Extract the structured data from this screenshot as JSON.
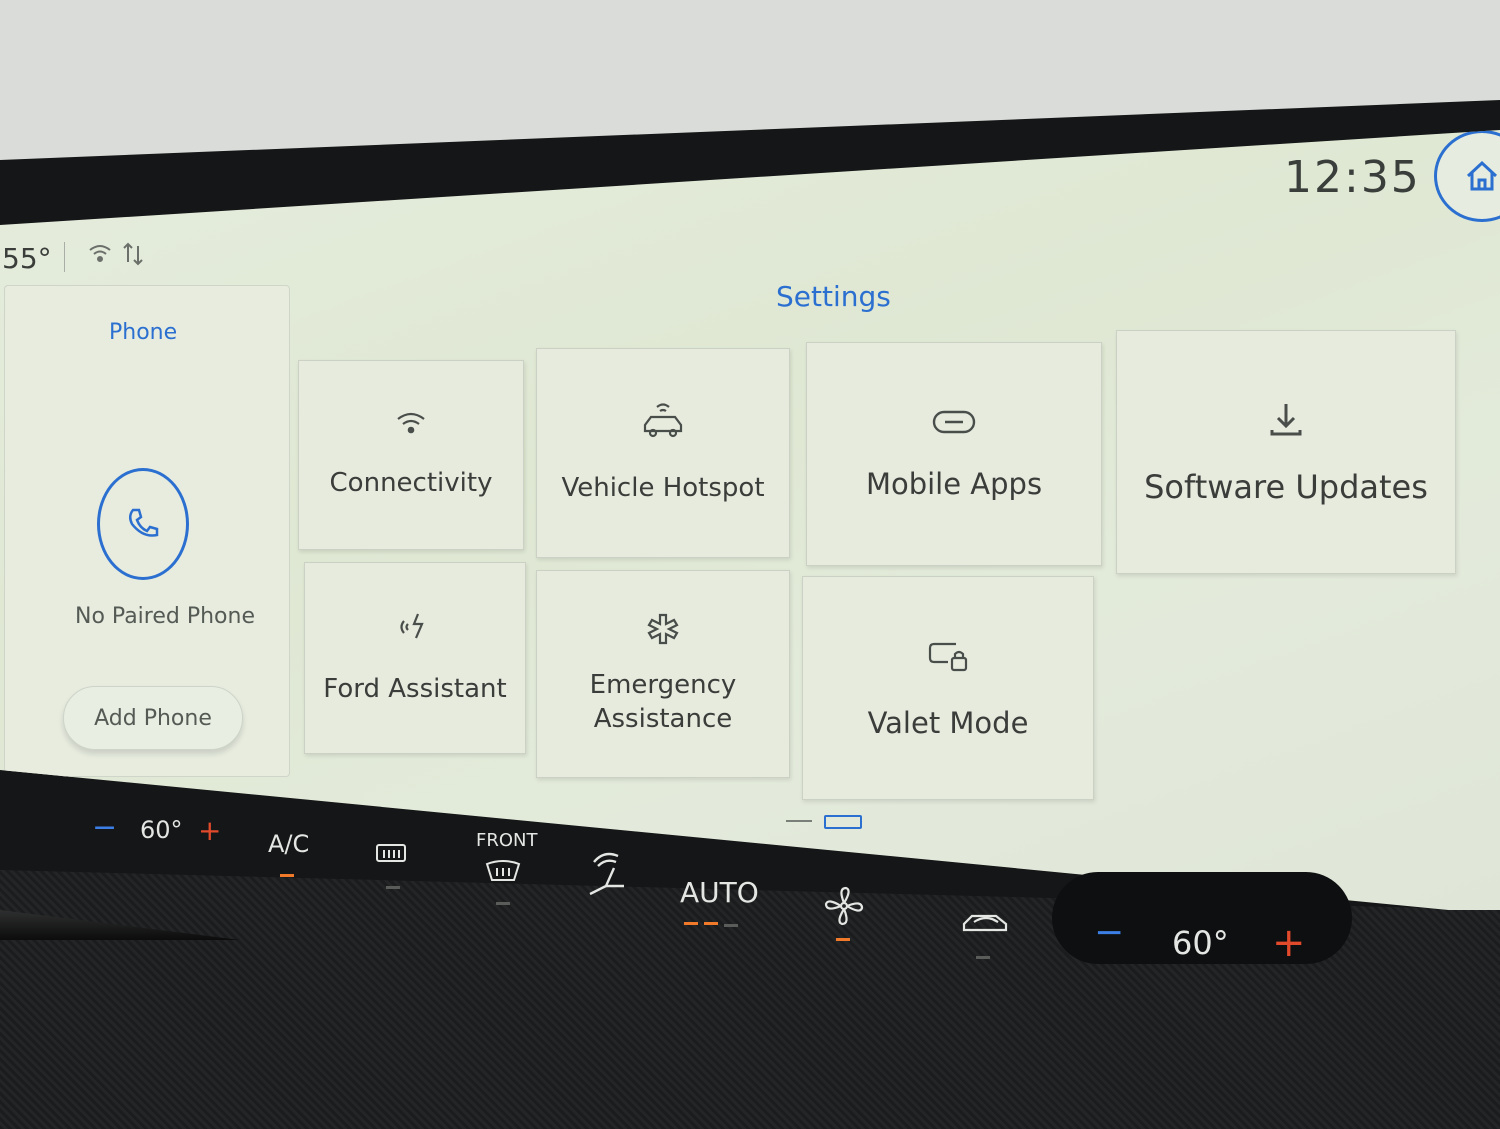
{
  "status": {
    "temperature": "55°",
    "wifi_icon": "wifi-icon",
    "signal_icon": "signal-icon"
  },
  "clock": "12:35",
  "home": {
    "icon": "home-icon"
  },
  "phone": {
    "title": "Phone",
    "status": "No Paired Phone",
    "add_button": "Add Phone",
    "icon": "phone-icon"
  },
  "settings": {
    "title": "Settings",
    "tiles": [
      {
        "label": "Connectivity",
        "icon": "wifi-icon"
      },
      {
        "label": "Vehicle Hotspot",
        "icon": "car-hotspot-icon"
      },
      {
        "label": "Mobile Apps",
        "icon": "link-icon"
      },
      {
        "label": "Software Updates",
        "icon": "download-icon"
      },
      {
        "label": "Ford Assistant",
        "icon": "voice-assistant-icon"
      },
      {
        "label": "Emergency Assistance",
        "icon": "emergency-icon"
      },
      {
        "label": "Valet Mode",
        "icon": "valet-lock-icon"
      }
    ],
    "page_count": 2,
    "current_page": 2
  },
  "climate": {
    "left_temp": "60°",
    "right_temp": "60°",
    "ac_label": "A/C",
    "front_label": "FRONT",
    "auto_label": "AUTO",
    "minus": "−",
    "plus": "+",
    "accent_on": "#f07a2a",
    "accent_blue": "#3b7fe6"
  },
  "colors": {
    "accent": "#2b6fd0",
    "screen_bg": "#e2e9da",
    "text": "#3a3d3a"
  }
}
